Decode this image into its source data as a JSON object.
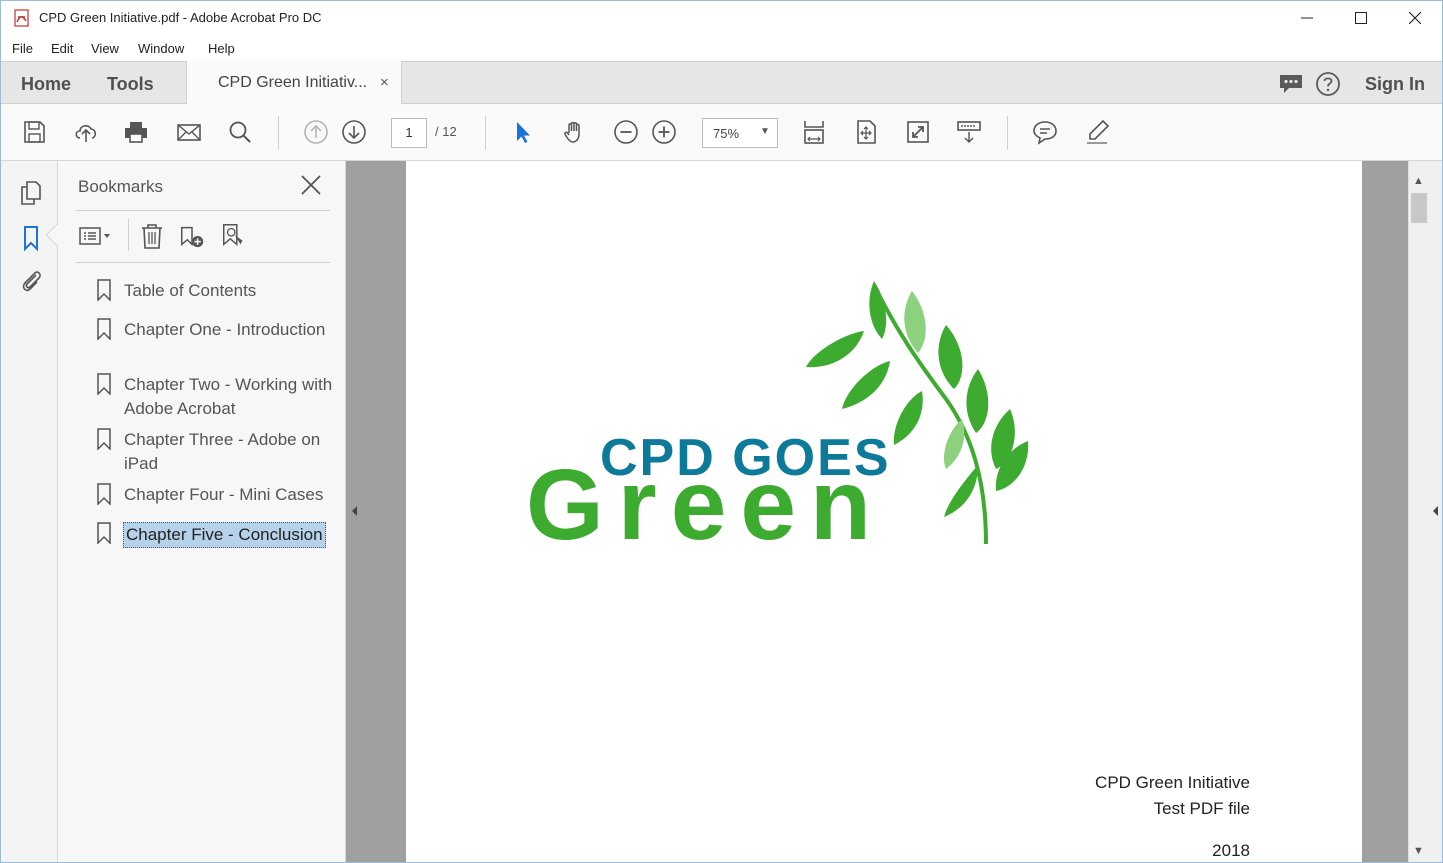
{
  "window": {
    "title": "CPD Green Initiative.pdf - Adobe Acrobat Pro DC",
    "controls": [
      "minimize-icon",
      "maximize-icon",
      "close-icon"
    ]
  },
  "menu": {
    "items": [
      "File",
      "Edit",
      "View",
      "Window",
      "Help"
    ]
  },
  "tabs": {
    "home": "Home",
    "tools": "Tools",
    "document": "CPD Green Initiativ...",
    "document_close": "×",
    "sign_in": "Sign In"
  },
  "toolbar": {
    "icons": [
      "save-icon",
      "upload-cloud-icon",
      "print-icon",
      "email-icon",
      "search-icon",
      "previous-page-icon",
      "next-page-icon",
      "select-arrow-icon",
      "hand-icon",
      "zoom-out-icon",
      "zoom-in-icon",
      "scrolling-mode-icon",
      "fit-page-icon",
      "full-screen-icon",
      "read-mode-icon",
      "comment-icon",
      "highlight-pen-icon"
    ],
    "page_current": "1",
    "page_total": "/ 12",
    "zoom": "75%",
    "zoom_caret": "▼"
  },
  "bookmarks": {
    "title": "Bookmarks",
    "items": [
      {
        "label": "Table of Contents"
      },
      {
        "label": "Chapter One - Introduction"
      },
      {
        "label": "Chapter Two - Working with Adobe Acrobat"
      },
      {
        "label": "Chapter Three - Adobe on iPad"
      },
      {
        "label": "Chapter Four - Mini Cases"
      },
      {
        "label": "Chapter Five - Conclusion",
        "selected": true
      }
    ]
  },
  "document": {
    "logo_line1": "CPD GOES",
    "logo_line2": "Green",
    "footer_line1": "CPD Green Initiative",
    "footer_line2": "Test PDF file",
    "footer_year": "2018"
  },
  "colors": {
    "logo_blue": "#0e7a9a",
    "logo_green": "#3cab2f",
    "leaf_light": "#8dd07e",
    "selection": "#b6d1ea",
    "toolbar_blue_arrow": "#1a73d9"
  }
}
